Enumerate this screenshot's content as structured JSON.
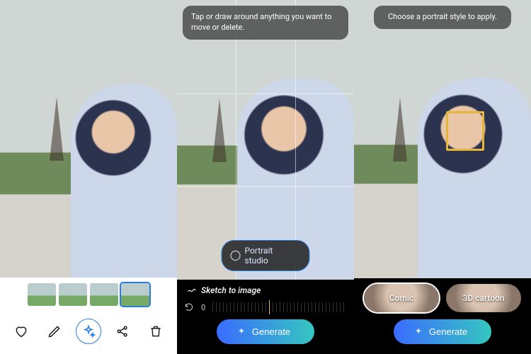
{
  "pane1": {
    "thumbs": [
      0,
      1,
      2,
      3
    ],
    "selected_index": 3,
    "actions": {
      "favorite_icon": "heart-icon",
      "edit_icon": "pencil-icon",
      "ai_icon": "sparkle-icon",
      "share_icon": "share-icon",
      "delete_icon": "trash-icon"
    }
  },
  "pane2": {
    "hint": "Tap or draw around anything you want to move or delete.",
    "portrait_chip": "Portrait studio",
    "sketch_label": "Sketch to image",
    "slider_value": "0",
    "generate_label": "Generate"
  },
  "pane3": {
    "hint": "Choose a portrait style to apply.",
    "styles": [
      {
        "label": "Comic",
        "selected": true
      },
      {
        "label": "3D cartoon",
        "selected": false
      }
    ],
    "generate_label": "Generate"
  }
}
